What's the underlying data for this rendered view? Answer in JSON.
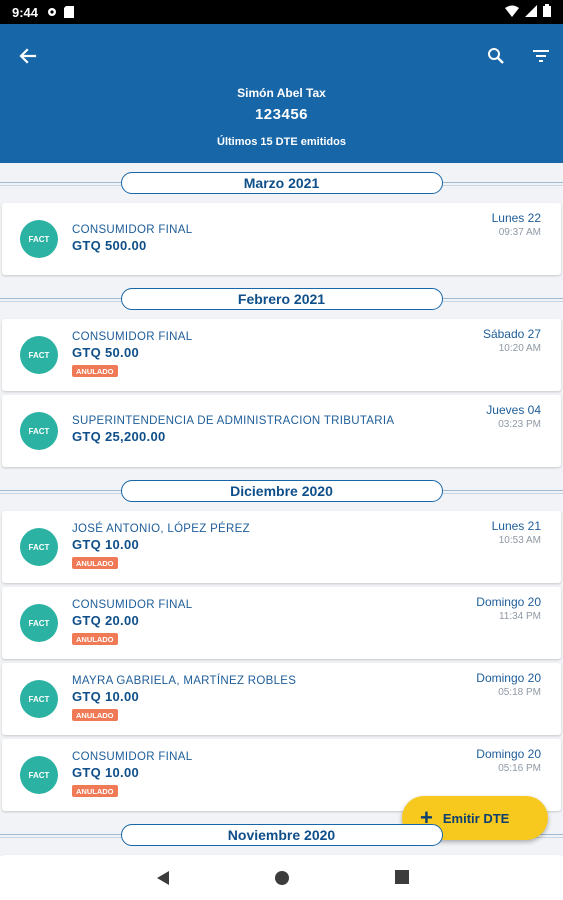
{
  "status_bar": {
    "time": "9:44"
  },
  "header": {
    "name": "Simón Abel Tax",
    "nit": "123456",
    "subtitle": "Últimos 15 DTE emitidos"
  },
  "groups": [
    {
      "month": "Marzo 2021",
      "items": [
        {
          "badge": "FACT",
          "client": "CONSUMIDOR FINAL",
          "amount": "GTQ 500.00",
          "status": "",
          "day": "Lunes 22",
          "time": "09:37 AM"
        }
      ]
    },
    {
      "month": "Febrero 2021",
      "items": [
        {
          "badge": "FACT",
          "client": "CONSUMIDOR FINAL",
          "amount": "GTQ 50.00",
          "status": "ANULADO",
          "day": "Sábado 27",
          "time": "10:20 AM"
        },
        {
          "badge": "FACT",
          "client": "SUPERINTENDENCIA DE ADMINISTRACION TRIBUTARIA",
          "amount": "GTQ 25,200.00",
          "status": "",
          "day": "Jueves 04",
          "time": "03:23 PM"
        }
      ]
    },
    {
      "month": "Diciembre 2020",
      "items": [
        {
          "badge": "FACT",
          "client": "JOSÉ ANTONIO, LÓPEZ PÉREZ",
          "amount": "GTQ 10.00",
          "status": "ANULADO",
          "day": "Lunes 21",
          "time": "10:53 AM"
        },
        {
          "badge": "FACT",
          "client": "CONSUMIDOR FINAL",
          "amount": "GTQ 20.00",
          "status": "ANULADO",
          "day": "Domingo 20",
          "time": "11:34 PM"
        },
        {
          "badge": "FACT",
          "client": "MAYRA GABRIELA, MARTÍNEZ ROBLES",
          "amount": "GTQ 10.00",
          "status": "ANULADO",
          "day": "Domingo 20",
          "time": "05:18 PM"
        },
        {
          "badge": "FACT",
          "client": "CONSUMIDOR FINAL",
          "amount": "GTQ 10.00",
          "status": "ANULADO",
          "day": "Domingo 20",
          "time": "05:16 PM"
        }
      ]
    },
    {
      "month": "Noviembre 2020",
      "items": []
    }
  ],
  "fab": {
    "label": "Emitir DTE",
    "icon": "plus-icon"
  },
  "colors": {
    "primary": "#1766a8",
    "avatar": "#2bb2a3",
    "annulled": "#ef7a55",
    "fab": "#f7c91e"
  }
}
